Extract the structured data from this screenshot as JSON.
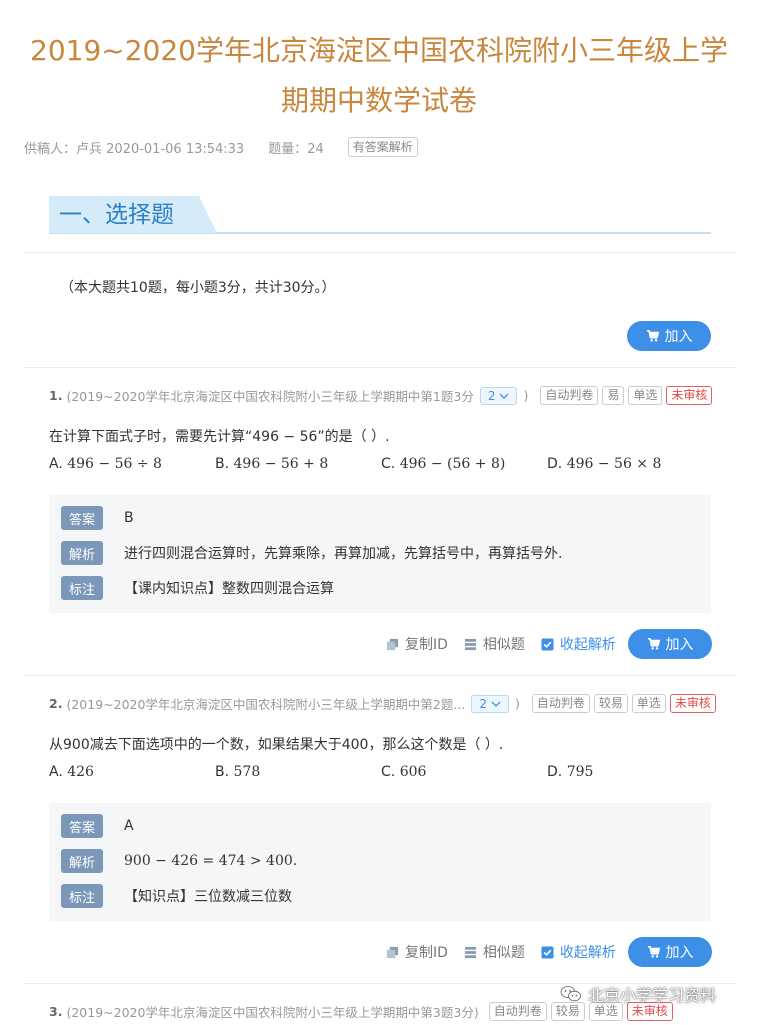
{
  "page": {
    "title_line1": "2019~2020学年北京海淀区中国农科院附小三年级上学",
    "title_line2": "期期中数学试卷",
    "meta": {
      "contributor": "供稿人：卢兵 2020-01-06 13:54:33",
      "count": "题量：24",
      "badge": "有答案解析"
    }
  },
  "section": {
    "title": "一、选择题",
    "intro": "（本大题共10题，每小题3分，共计30分。）"
  },
  "add_label": "加入",
  "questions": [
    {
      "num": "1.",
      "source": "(2019~2020学年北京海淀区中国农科院附小三年级上学期期中第1题3分",
      "version": "2",
      "close_paren": ")",
      "tags": [
        "自动判卷",
        "易",
        "单选"
      ],
      "status_tag": "未审核",
      "stem": "在计算下面式子时，需要先计算“496 − 56”的是（  ）.",
      "options": [
        {
          "letter": "A.",
          "text": "496 − 56 ÷ 8"
        },
        {
          "letter": "B.",
          "text": "496 − 56 + 8"
        },
        {
          "letter": "C.",
          "text": "496 − (56 + 8)"
        },
        {
          "letter": "D.",
          "text": "496 − 56 × 8"
        }
      ],
      "answer_label": "答案",
      "answer": "B",
      "analysis_label": "解析",
      "analysis": "进行四则混合运算时，先算乘除，再算加减，先算括号中，再算括号外.",
      "note_label": "标注",
      "note": "【课内知识点】整数四则混合运算"
    },
    {
      "num": "2.",
      "source": "(2019~2020学年北京海淀区中国农科院附小三年级上学期期中第2题...",
      "version": "2",
      "close_paren": ")",
      "tags": [
        "自动判卷",
        "较易",
        "单选"
      ],
      "status_tag": "未审核",
      "stem": "从900减去下面选项中的一个数，如果结果大于400，那么这个数是（  ）.",
      "options": [
        {
          "letter": "A.",
          "text": "426"
        },
        {
          "letter": "B.",
          "text": "578"
        },
        {
          "letter": "C.",
          "text": "606"
        },
        {
          "letter": "D.",
          "text": "795"
        }
      ],
      "answer_label": "答案",
      "answer": "A",
      "analysis_label": "解析",
      "analysis": "900 − 426 = 474 > 400.",
      "note_label": "标注",
      "note": "【知识点】三位数减三位数"
    },
    {
      "num": "3.",
      "source": "(2019~2020学年北京海淀区中国农科院附小三年级上学期期中第3题3分)",
      "tags": [
        "自动判卷",
        "较易",
        "单选"
      ],
      "status_tag": "未审核"
    }
  ],
  "actions": {
    "copy_id": "复制ID",
    "similar": "相似题",
    "collapse": "收起解析"
  },
  "watermark": "北京小学学习资料"
}
